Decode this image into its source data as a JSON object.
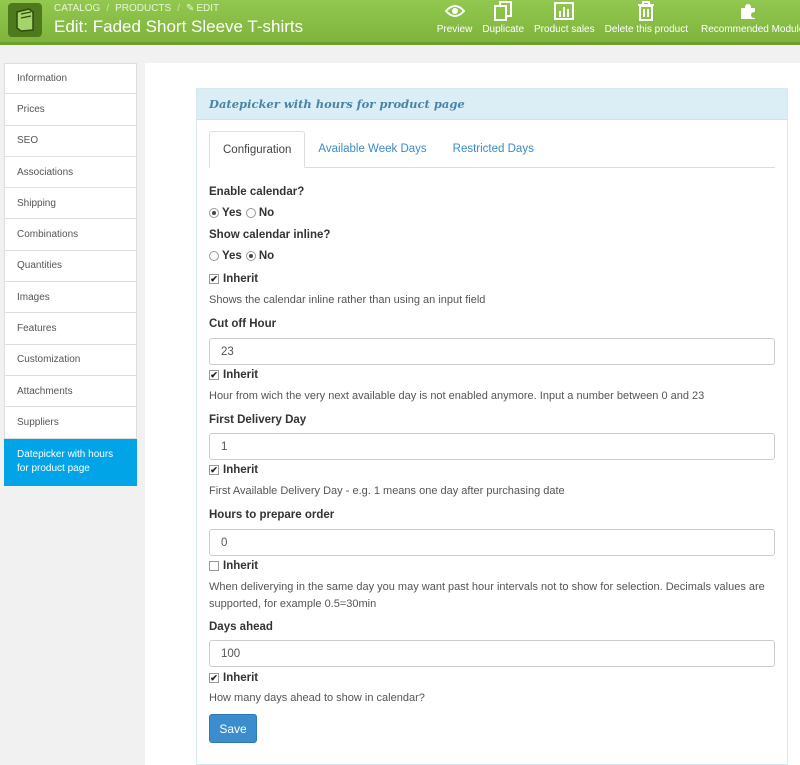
{
  "header": {
    "breadcrumb": [
      "CATALOG",
      "PRODUCTS",
      "EDIT"
    ],
    "title": "Edit: Faded Short Sleeve T-shirts",
    "toolbar": [
      {
        "label": "Preview",
        "icon": "eye-icon"
      },
      {
        "label": "Duplicate",
        "icon": "copy-icon"
      },
      {
        "label": "Product sales",
        "icon": "bar-chart-icon"
      },
      {
        "label": "Delete this product",
        "icon": "trash-icon"
      },
      {
        "label": "Recommended Modules",
        "icon": "puzzle-icon"
      }
    ]
  },
  "sidebar": {
    "items": [
      {
        "label": "Information"
      },
      {
        "label": "Prices"
      },
      {
        "label": "SEO"
      },
      {
        "label": "Associations"
      },
      {
        "label": "Shipping"
      },
      {
        "label": "Combinations"
      },
      {
        "label": "Quantities"
      },
      {
        "label": "Images"
      },
      {
        "label": "Features"
      },
      {
        "label": "Customization"
      },
      {
        "label": "Attachments"
      },
      {
        "label": "Suppliers"
      },
      {
        "label": "Datepicker with hours for product page",
        "active": true
      }
    ]
  },
  "panel": {
    "title": "Datepicker with hours for product page",
    "tabs": [
      {
        "label": "Configuration",
        "active": true
      },
      {
        "label": "Available Week Days"
      },
      {
        "label": "Restricted Days"
      }
    ]
  },
  "form": {
    "enable_calendar": {
      "label": "Enable calendar?",
      "yes": "Yes",
      "no": "No",
      "selected": "Yes"
    },
    "show_inline": {
      "label": "Show calendar inline?",
      "yes": "Yes",
      "no": "No",
      "selected": "No",
      "inherit_label": "Inherit",
      "inherit": true,
      "help": "Shows the calendar inline rather than using an input field"
    },
    "cut_off_hour": {
      "label": "Cut off Hour",
      "value": "23",
      "inherit_label": "Inherit",
      "inherit": true,
      "help": "Hour from wich the very next available day is not enabled anymore. Input a number between 0 and 23"
    },
    "first_delivery_day": {
      "label": "First Delivery Day",
      "value": "1",
      "inherit_label": "Inherit",
      "inherit": true,
      "help": "First Available Delivery Day - e.g. 1 means one day after purchasing date"
    },
    "hours_to_prepare": {
      "label": "Hours to prepare order",
      "value": "0",
      "inherit_label": "Inherit",
      "inherit": false,
      "help": "When deliverying in the same day you may want past hour intervals not to show for selection. Decimals values are supported, for example 0.5=30min"
    },
    "days_ahead": {
      "label": "Days ahead",
      "value": "100",
      "inherit_label": "Inherit",
      "inherit": true,
      "help": "How many days ahead to show in calendar?"
    },
    "save_label": "Save"
  },
  "colors": {
    "header": "#8bc34a",
    "active_sidebar": "#00a4e7",
    "save_button": "#3b8dcd",
    "link": "#3a8cc5"
  }
}
